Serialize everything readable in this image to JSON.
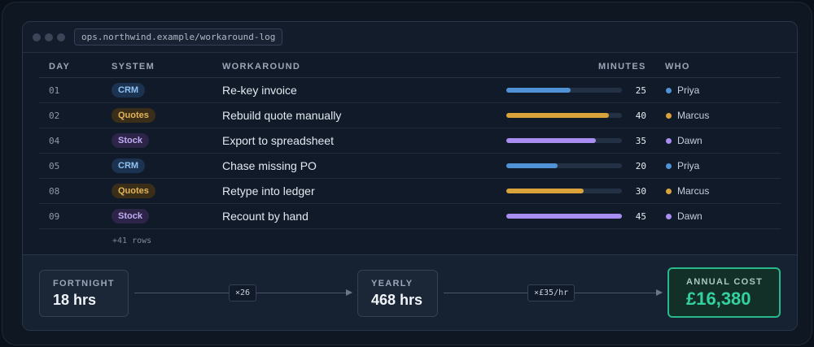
{
  "window": {
    "address": "ops.northwind.example/workaround-log"
  },
  "columns": {
    "day": "DAY",
    "system": "SYSTEM",
    "workaround": "WORKAROUND",
    "minutes": "MINUTES",
    "who": "WHO"
  },
  "colors": {
    "crm": "#4f93d6",
    "quotes": "#d9a23a",
    "stock": "#a98df0",
    "annual_cost": "#33d29c"
  },
  "rows": [
    {
      "day": "01",
      "system": "CRM",
      "system_key": "crm",
      "workaround": "Re-key invoice",
      "minutes": "25",
      "who": "Priya"
    },
    {
      "day": "02",
      "system": "Quotes",
      "system_key": "quotes",
      "workaround": "Rebuild quote manually",
      "minutes": "40",
      "who": "Marcus"
    },
    {
      "day": "04",
      "system": "Stock",
      "system_key": "stock",
      "workaround": "Export to spreadsheet",
      "minutes": "35",
      "who": "Dawn"
    },
    {
      "day": "05",
      "system": "CRM",
      "system_key": "crm",
      "workaround": "Chase missing PO",
      "minutes": "20",
      "who": "Priya"
    },
    {
      "day": "08",
      "system": "Quotes",
      "system_key": "quotes",
      "workaround": "Retype into ledger",
      "minutes": "30",
      "who": "Marcus"
    },
    {
      "day": "09",
      "system": "Stock",
      "system_key": "stock",
      "workaround": "Recount by hand",
      "minutes": "45",
      "who": "Dawn"
    }
  ],
  "bar_max_minutes": 45,
  "more_rows": "+41 rows",
  "summary": {
    "fortnight_label": "FORTNIGHT",
    "fortnight_value": "18 hrs",
    "multiplier1": "×26",
    "yearly_label": "YEARLY",
    "yearly_value": "468 hrs",
    "multiplier2": "×£35/hr",
    "cost_label": "ANNUAL COST",
    "cost_value": "£16,380"
  }
}
